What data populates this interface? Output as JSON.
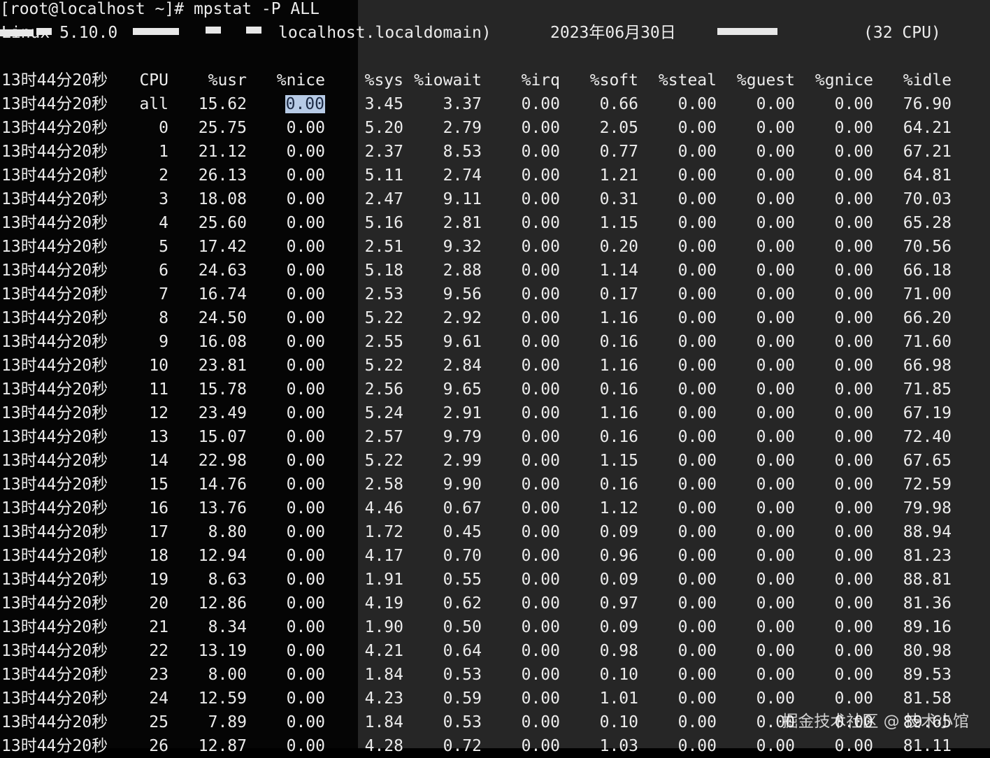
{
  "prompt": "[root@localhost ~]# mpstat -P ALL",
  "sysinfo": {
    "kernel": "Linux 5.10.0",
    "hostname": "localhost.localdomain)",
    "date": "2023年06月30日",
    "cpu_count": "(32 CPU)"
  },
  "headers": [
    "13时44分20秒",
    "CPU",
    "%usr",
    "%nice",
    "%sys",
    "%iowait",
    "%irq",
    "%soft",
    "%steal",
    "%guest",
    "%gnice",
    "%idle"
  ],
  "rows": [
    [
      "13时44分20秒",
      "all",
      "15.62",
      "0.00",
      "3.45",
      "3.37",
      "0.00",
      "0.66",
      "0.00",
      "0.00",
      "0.00",
      "76.90"
    ],
    [
      "13时44分20秒",
      "0",
      "25.75",
      "0.00",
      "5.20",
      "2.79",
      "0.00",
      "2.05",
      "0.00",
      "0.00",
      "0.00",
      "64.21"
    ],
    [
      "13时44分20秒",
      "1",
      "21.12",
      "0.00",
      "2.37",
      "8.53",
      "0.00",
      "0.77",
      "0.00",
      "0.00",
      "0.00",
      "67.21"
    ],
    [
      "13时44分20秒",
      "2",
      "26.13",
      "0.00",
      "5.11",
      "2.74",
      "0.00",
      "1.21",
      "0.00",
      "0.00",
      "0.00",
      "64.81"
    ],
    [
      "13时44分20秒",
      "3",
      "18.08",
      "0.00",
      "2.47",
      "9.11",
      "0.00",
      "0.31",
      "0.00",
      "0.00",
      "0.00",
      "70.03"
    ],
    [
      "13时44分20秒",
      "4",
      "25.60",
      "0.00",
      "5.16",
      "2.81",
      "0.00",
      "1.15",
      "0.00",
      "0.00",
      "0.00",
      "65.28"
    ],
    [
      "13时44分20秒",
      "5",
      "17.42",
      "0.00",
      "2.51",
      "9.32",
      "0.00",
      "0.20",
      "0.00",
      "0.00",
      "0.00",
      "70.56"
    ],
    [
      "13时44分20秒",
      "6",
      "24.63",
      "0.00",
      "5.18",
      "2.88",
      "0.00",
      "1.14",
      "0.00",
      "0.00",
      "0.00",
      "66.18"
    ],
    [
      "13时44分20秒",
      "7",
      "16.74",
      "0.00",
      "2.53",
      "9.56",
      "0.00",
      "0.17",
      "0.00",
      "0.00",
      "0.00",
      "71.00"
    ],
    [
      "13时44分20秒",
      "8",
      "24.50",
      "0.00",
      "5.22",
      "2.92",
      "0.00",
      "1.16",
      "0.00",
      "0.00",
      "0.00",
      "66.20"
    ],
    [
      "13时44分20秒",
      "9",
      "16.08",
      "0.00",
      "2.55",
      "9.61",
      "0.00",
      "0.16",
      "0.00",
      "0.00",
      "0.00",
      "71.60"
    ],
    [
      "13时44分20秒",
      "10",
      "23.81",
      "0.00",
      "5.22",
      "2.84",
      "0.00",
      "1.16",
      "0.00",
      "0.00",
      "0.00",
      "66.98"
    ],
    [
      "13时44分20秒",
      "11",
      "15.78",
      "0.00",
      "2.56",
      "9.65",
      "0.00",
      "0.16",
      "0.00",
      "0.00",
      "0.00",
      "71.85"
    ],
    [
      "13时44分20秒",
      "12",
      "23.49",
      "0.00",
      "5.24",
      "2.91",
      "0.00",
      "1.16",
      "0.00",
      "0.00",
      "0.00",
      "67.19"
    ],
    [
      "13时44分20秒",
      "13",
      "15.07",
      "0.00",
      "2.57",
      "9.79",
      "0.00",
      "0.16",
      "0.00",
      "0.00",
      "0.00",
      "72.40"
    ],
    [
      "13时44分20秒",
      "14",
      "22.98",
      "0.00",
      "5.22",
      "2.99",
      "0.00",
      "1.15",
      "0.00",
      "0.00",
      "0.00",
      "67.65"
    ],
    [
      "13时44分20秒",
      "15",
      "14.76",
      "0.00",
      "2.58",
      "9.90",
      "0.00",
      "0.16",
      "0.00",
      "0.00",
      "0.00",
      "72.59"
    ],
    [
      "13时44分20秒",
      "16",
      "13.76",
      "0.00",
      "4.46",
      "0.67",
      "0.00",
      "1.12",
      "0.00",
      "0.00",
      "0.00",
      "79.98"
    ],
    [
      "13时44分20秒",
      "17",
      "8.80",
      "0.00",
      "1.72",
      "0.45",
      "0.00",
      "0.09",
      "0.00",
      "0.00",
      "0.00",
      "88.94"
    ],
    [
      "13时44分20秒",
      "18",
      "12.94",
      "0.00",
      "4.17",
      "0.70",
      "0.00",
      "0.96",
      "0.00",
      "0.00",
      "0.00",
      "81.23"
    ],
    [
      "13时44分20秒",
      "19",
      "8.63",
      "0.00",
      "1.91",
      "0.55",
      "0.00",
      "0.09",
      "0.00",
      "0.00",
      "0.00",
      "88.81"
    ],
    [
      "13时44分20秒",
      "20",
      "12.86",
      "0.00",
      "4.19",
      "0.62",
      "0.00",
      "0.97",
      "0.00",
      "0.00",
      "0.00",
      "81.36"
    ],
    [
      "13时44分20秒",
      "21",
      "8.34",
      "0.00",
      "1.90",
      "0.50",
      "0.00",
      "0.09",
      "0.00",
      "0.00",
      "0.00",
      "89.16"
    ],
    [
      "13时44分20秒",
      "22",
      "13.19",
      "0.00",
      "4.21",
      "0.64",
      "0.00",
      "0.98",
      "0.00",
      "0.00",
      "0.00",
      "80.98"
    ],
    [
      "13时44分20秒",
      "23",
      "8.00",
      "0.00",
      "1.84",
      "0.53",
      "0.00",
      "0.10",
      "0.00",
      "0.00",
      "0.00",
      "89.53"
    ],
    [
      "13时44分20秒",
      "24",
      "12.59",
      "0.00",
      "4.23",
      "0.59",
      "0.00",
      "1.01",
      "0.00",
      "0.00",
      "0.00",
      "81.58"
    ],
    [
      "13时44分20秒",
      "25",
      "7.89",
      "0.00",
      "1.84",
      "0.53",
      "0.00",
      "0.10",
      "0.00",
      "0.00",
      "0.00",
      "89.65"
    ],
    [
      "13时44分20秒",
      "26",
      "12.87",
      "0.00",
      "4.28",
      "0.72",
      "0.00",
      "1.03",
      "0.00",
      "0.00",
      "0.00",
      "81.11"
    ]
  ],
  "selected_cell_text": "0.00",
  "watermark": "掘金技术社区 @ 技术小馆"
}
